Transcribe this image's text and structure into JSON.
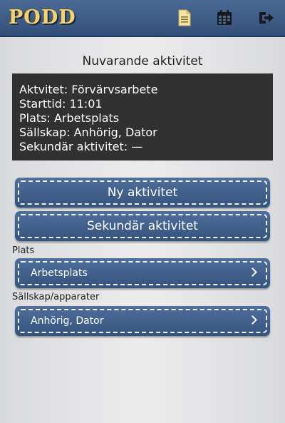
{
  "app": {
    "logo": "PODD"
  },
  "toolbar": {
    "icons": [
      "document-icon",
      "calendar-icon",
      "exit-icon"
    ]
  },
  "current": {
    "title": "Nuvarande aktivitet",
    "lines": [
      "Aktvitet: Förvärvsarbete",
      "Starttid: 11:01",
      "Plats: Arbetsplats",
      "Sällskap: Anhörig, Dator",
      "Sekundär aktivitet: —"
    ]
  },
  "buttons": {
    "new_activity": "Ny aktivitet",
    "secondary_activity": "Sekundär aktivitet"
  },
  "place": {
    "label": "Plats",
    "value": "Arbetsplats"
  },
  "company": {
    "label": "Sällskap/apparater",
    "value": "Anhörig, Dator"
  },
  "colors": {
    "topbar": "#3d5d88",
    "button": "#3f5f8c",
    "logo": "#f4d27a",
    "info_bg": "#313131"
  }
}
